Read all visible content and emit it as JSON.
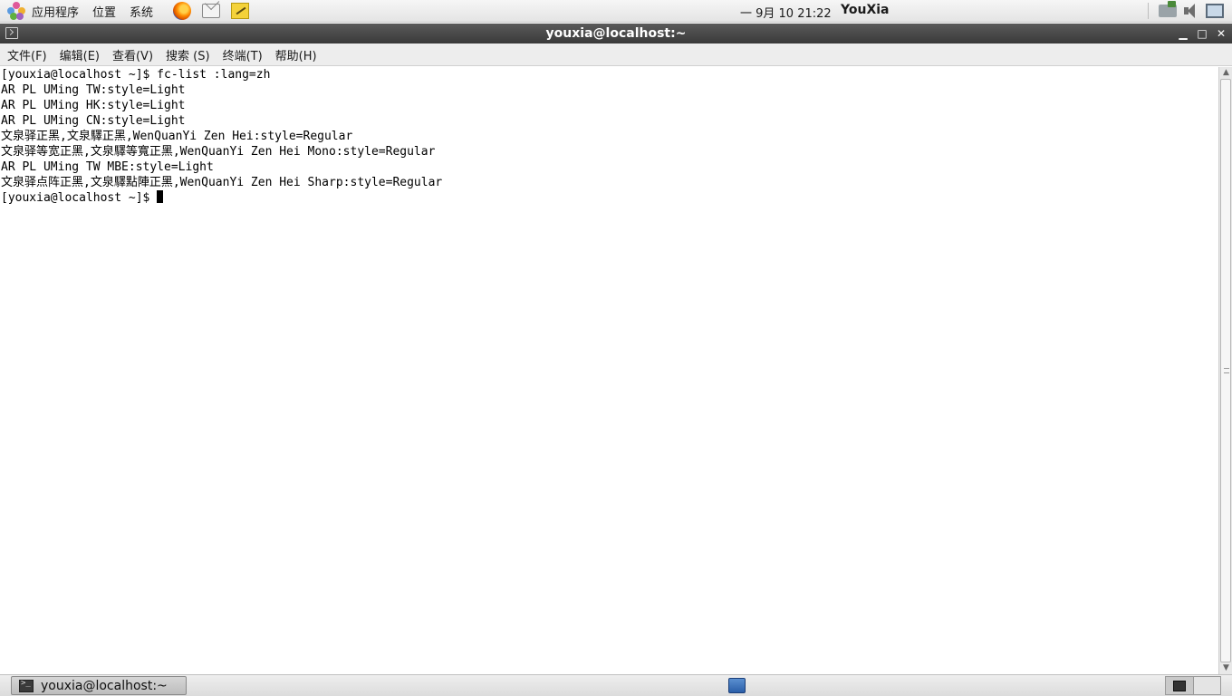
{
  "top_panel": {
    "menus": [
      "应用程序",
      "位置",
      "系统"
    ],
    "clock": "一 9月 10 21:22",
    "user": "YouXia"
  },
  "window": {
    "title": "youxia@localhost:~",
    "menu": [
      "文件(F)",
      "编辑(E)",
      "查看(V)",
      "搜索 (S)",
      "终端(T)",
      "帮助(H)"
    ]
  },
  "terminal": {
    "lines": [
      "[youxia@localhost ~]$ fc-list :lang=zh",
      "AR PL UMing TW:style=Light",
      "AR PL UMing HK:style=Light",
      "AR PL UMing CN:style=Light",
      "文泉驿正黑,文泉驛正黑,WenQuanYi Zen Hei:style=Regular",
      "文泉驿等宽正黑,文泉驛等寬正黑,WenQuanYi Zen Hei Mono:style=Regular",
      "AR PL UMing TW MBE:style=Light",
      "文泉驿点阵正黑,文泉驛點陣正黑,WenQuanYi Zen Hei Sharp:style=Regular"
    ],
    "prompt": "[youxia@localhost ~]$ "
  },
  "taskbar": {
    "task_label": "youxia@localhost:~"
  }
}
